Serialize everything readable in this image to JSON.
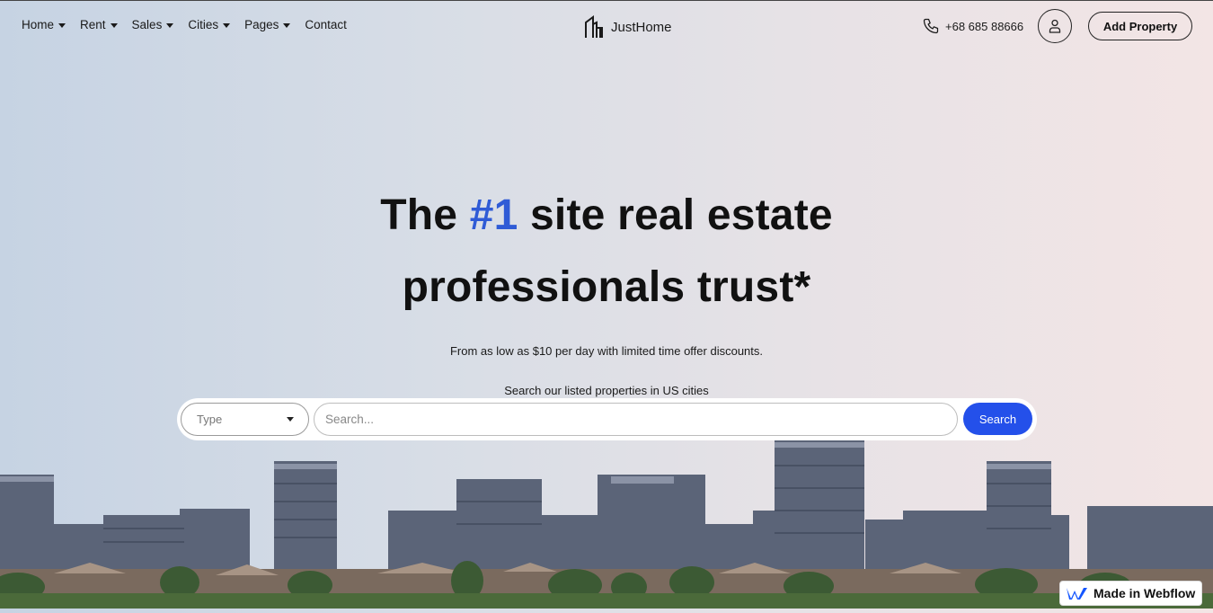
{
  "nav": {
    "menu": [
      {
        "label": "Home",
        "dropdown": true
      },
      {
        "label": "Rent",
        "dropdown": true
      },
      {
        "label": "Sales",
        "dropdown": true
      },
      {
        "label": "Cities",
        "dropdown": true
      },
      {
        "label": "Pages",
        "dropdown": true
      },
      {
        "label": "Contact",
        "dropdown": false
      }
    ],
    "logo_text": "JustHome",
    "phone": "+68 685 88666",
    "add_property": "Add Property"
  },
  "hero": {
    "title_part1": "The ",
    "title_accent": "#1",
    "title_part2": " site real estate",
    "title_line2": "professionals trust*",
    "subtitle": "From as low as $10 per day with limited time offer discounts.",
    "search_label": "Search our listed properties in US cities"
  },
  "search": {
    "type_value": "Type",
    "placeholder": "Search...",
    "button": "Search"
  },
  "badge": {
    "label": "Made in Webflow"
  },
  "colors": {
    "accent": "#2f5bd6",
    "search_button": "#2450ea"
  }
}
